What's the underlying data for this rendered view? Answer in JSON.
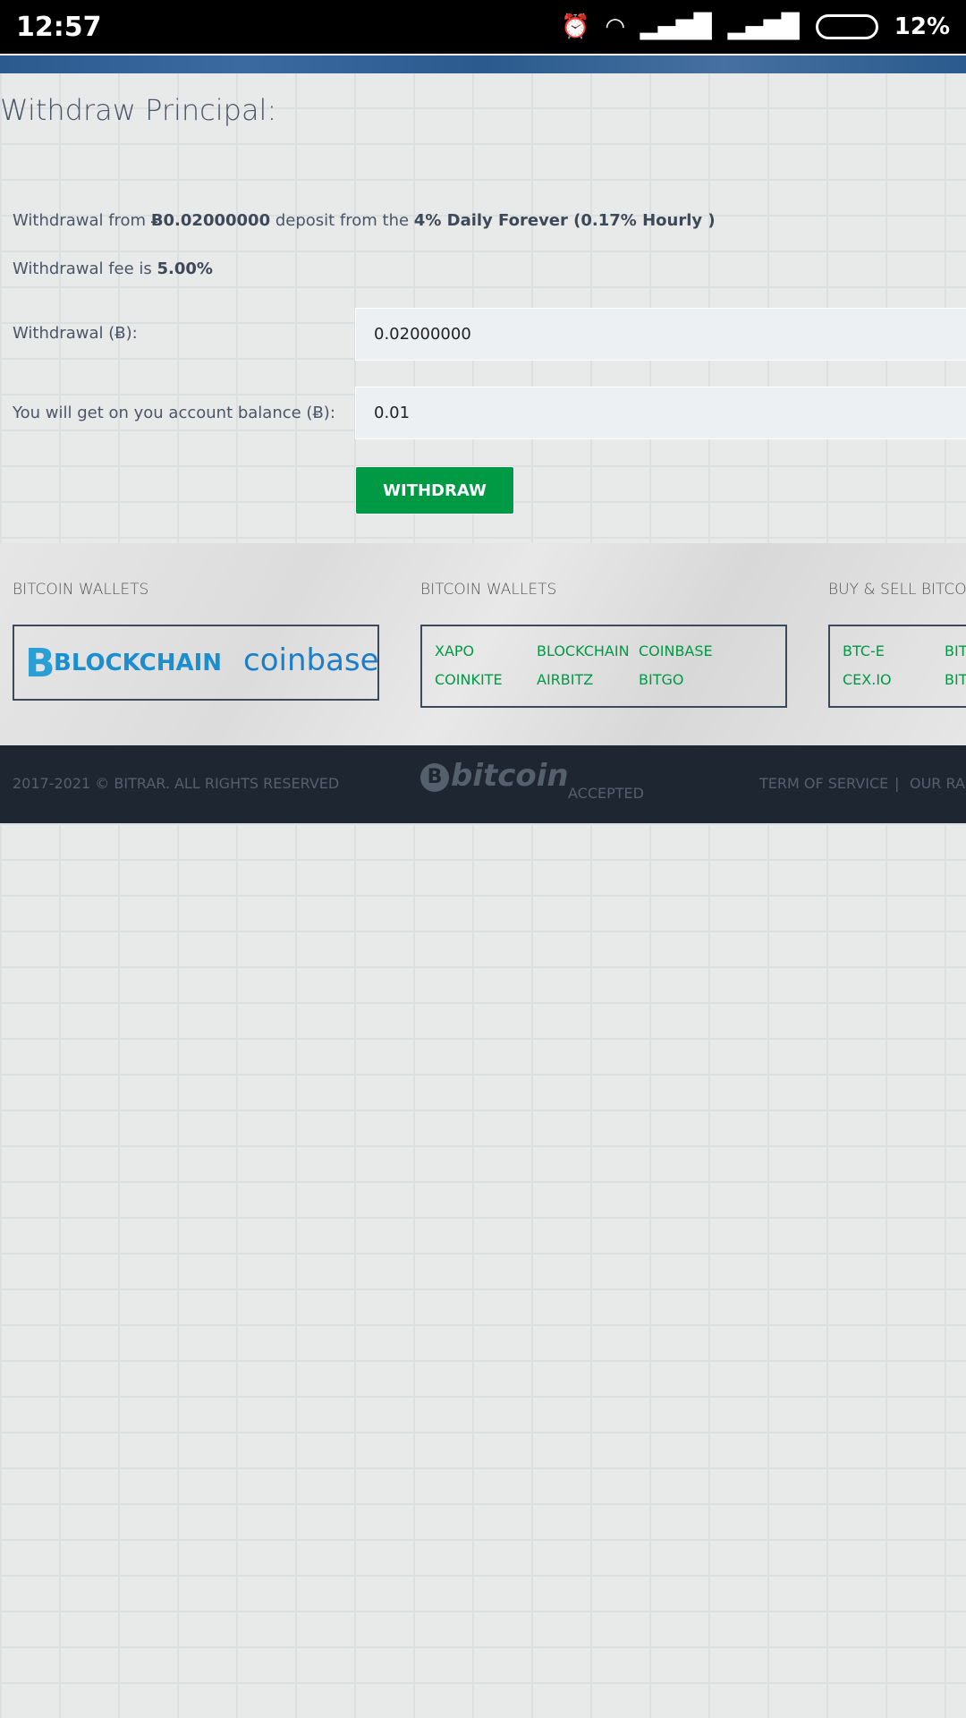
{
  "status_bar": {
    "time": "12:57",
    "battery": "12%"
  },
  "page": {
    "title": "Withdraw Principal:",
    "info_prefix": "Withdrawal from ",
    "info_amount": "Ƀ0.02000000",
    "info_mid": " deposit from the ",
    "info_plan": "4% Daily Forever (0.17% Hourly )",
    "fee_prefix": "Withdrawal fee is ",
    "fee_value": "5.00%",
    "withdrawal_label": "Withdrawal (Ƀ):",
    "withdrawal_value": "0.02000000",
    "balance_label": "You will get on you account balance (Ƀ):",
    "balance_value": "0.01",
    "withdraw_button": "WITHDRAW"
  },
  "links": {
    "col1": {
      "heading": "BITCOIN WALLETS",
      "logo1": "BLOCKCHAIN",
      "logo2": "coinbase"
    },
    "col2": {
      "heading": "BITCOIN WALLETS",
      "items": [
        "XAPO",
        "BLOCKCHAIN",
        "COINBASE",
        "COINKITE",
        "AIRBITZ",
        "BITGO"
      ]
    },
    "col3": {
      "heading": "BUY & SELL BITCO",
      "items": [
        "BTC-E",
        "BIT",
        "CEX.IO",
        "BIT"
      ]
    }
  },
  "footer": {
    "copyright": "2017-2021 © BITRAR. ALL RIGHTS RESERVED",
    "bitcoin_logo": "bitcoin",
    "accepted": "ACCEPTED",
    "terms": "TERM OF SERVICE",
    "sep": "|",
    "rates": "OUR RA"
  },
  "colors": {
    "accent": "#009944",
    "footer_bg": "#1e2631"
  }
}
